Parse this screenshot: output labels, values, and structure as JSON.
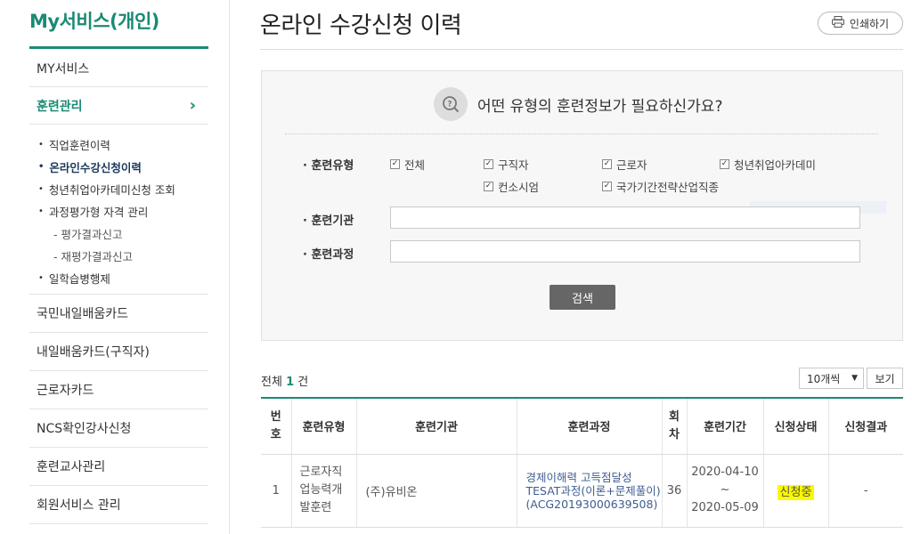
{
  "sidebar": {
    "title": "My서비스(개인)",
    "items": [
      {
        "label": "MY서비스"
      },
      {
        "label": "훈련관리"
      },
      {
        "label": "국민내일배움카드"
      },
      {
        "label": "내일배움카드(구직자)"
      },
      {
        "label": "근로자카드"
      },
      {
        "label": "NCS확인강사신청"
      },
      {
        "label": "훈련교사관리"
      },
      {
        "label": "회원서비스 관리"
      }
    ],
    "sub_items": [
      {
        "label": "직업훈련이력"
      },
      {
        "label": "온라인수강신청이력"
      },
      {
        "label": "청년취업아카데미신청 조회"
      },
      {
        "label": "과정평가형 자격 관리"
      },
      {
        "label": "평가결과신고"
      },
      {
        "label": "재평가결과신고"
      },
      {
        "label": "일학습병행제"
      }
    ]
  },
  "header": {
    "title": "온라인 수강신청 이력",
    "print_label": "인쇄하기"
  },
  "search": {
    "question": "어떤 유형의 훈련정보가 필요하신가요?",
    "type_label": "훈련유형",
    "types": [
      "전체",
      "구직자",
      "근로자",
      "청년취업아카데미",
      "컨소시엄",
      "국가기간전략산업직종"
    ],
    "org_label": "훈련기관",
    "course_label": "훈련과정",
    "button": "검색"
  },
  "results": {
    "total_prefix": "전체",
    "total_count": "1",
    "total_suffix": "건",
    "page_size": "10개씩",
    "view_button": "보기",
    "columns": [
      "번호",
      "훈련유형",
      "훈련기관",
      "훈련과정",
      "회차",
      "훈련기간",
      "신청상태",
      "신청결과"
    ],
    "rows": [
      {
        "no": "1",
        "type": "근로자직업능력개발훈련",
        "org": "(주)유비온",
        "course": "경제이해력 고득점달성 TESAT과정(이론+문제풀이)(ACG20193000639508)",
        "round": "36",
        "period_start": "2020-04-10 ~",
        "period_end": "2020-05-09",
        "status": "신청중",
        "result": "-"
      }
    ]
  },
  "colors": {
    "accent": "#1b8a73",
    "link": "#3d5d8f",
    "highlight": "#fbf800"
  }
}
